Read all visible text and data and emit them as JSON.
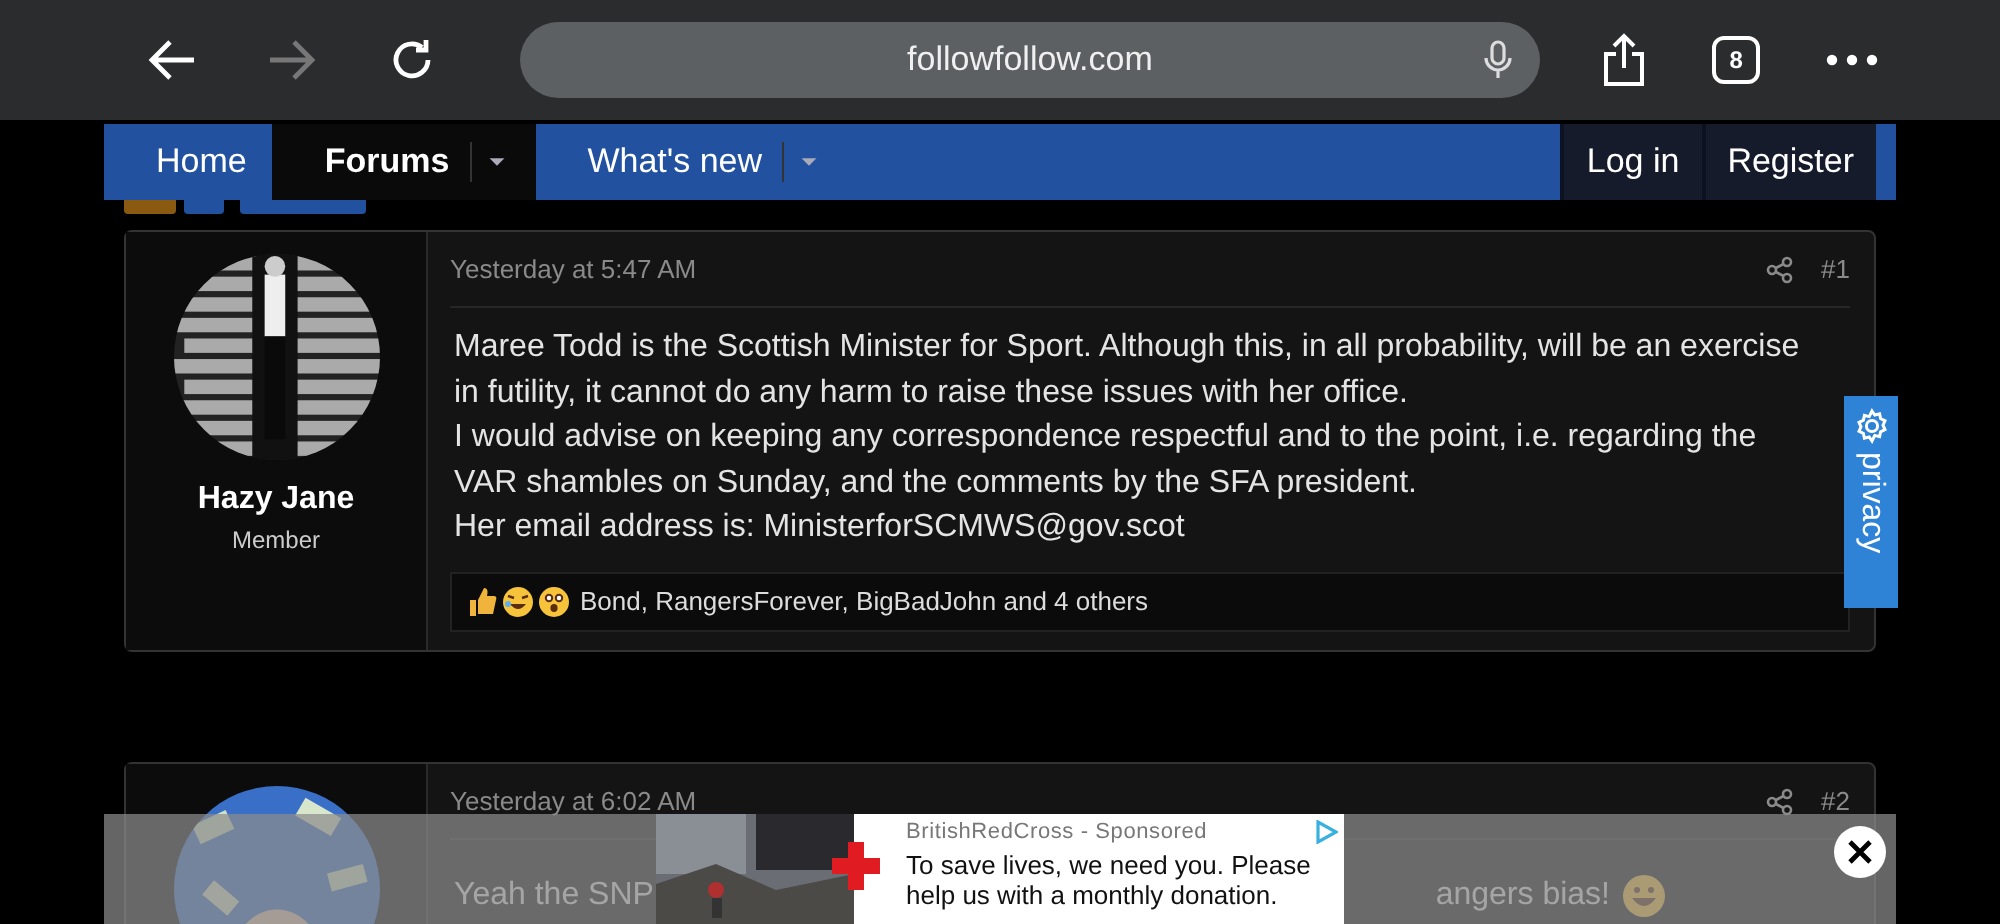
{
  "browser": {
    "url": "followfollow.com",
    "tab_count": "8"
  },
  "nav": {
    "items": [
      {
        "label": "Home",
        "selected": false,
        "dropdown": false
      },
      {
        "label": "Forums",
        "selected": true,
        "dropdown": true
      },
      {
        "label": "What's new",
        "selected": false,
        "dropdown": true
      }
    ],
    "account": [
      "Log in",
      "Register"
    ]
  },
  "posts": [
    {
      "author": "Hazy Jane",
      "role": "Member",
      "time": "Yesterday at 5:47 AM",
      "number": "#1",
      "paragraphs": [
        "Maree Todd is the Scottish Minister for Sport. Although this, in all probability, will be an exercise in futility, it cannot do any harm to raise these issues with her office.",
        "I would advise on keeping any correspondence respectful and to the point, i.e. regarding the VAR shambles on Sunday, and the comments by the SFA president.",
        "Her email address is: MinisterforSCMWS@gov.scot"
      ],
      "reactions": "Bond, RangersForever, BigBadJohn and 4 others"
    },
    {
      "time": "Yesterday at 6:02 AM",
      "number": "#2",
      "message_parts": [
        "Yeah the SNP",
        "angers bias!"
      ]
    }
  ],
  "privacy_tab": {
    "label": "privacy"
  },
  "ad": {
    "sponsor": "BritishRedCross - Sponsored",
    "text": "To save lives, we need you. Please help us with a monthly donation."
  }
}
